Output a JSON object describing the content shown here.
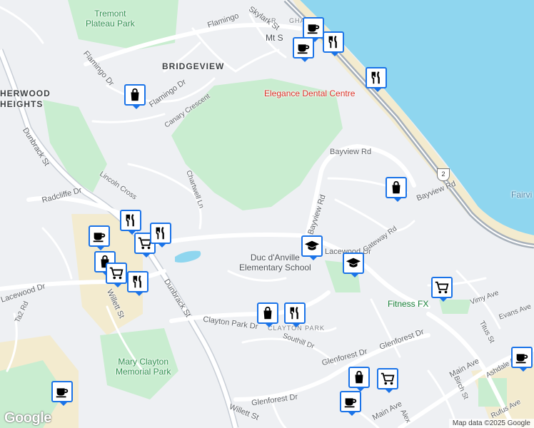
{
  "labels": {
    "park_tremont": "Tremont\nPlateau Park",
    "bridgeview": "BRIDGEVIEW",
    "herwood": "HERWOOD\nHEIGHTS",
    "flamingo_dr_1": "Flamingo Dr",
    "flamingo_dr_2": "Flamingo Dr",
    "flamingo_dr_3": "Flamingo",
    "skylark": "Skylark St",
    "canary": "Canary Crescent",
    "dunbrack_n": "Dunbrack St",
    "dunbrack_s": "Dunbrack St",
    "lincoln": "Lincoln Cross",
    "chartwell": "Chartwell Ln",
    "radcliffe": "Radcliffe Dr",
    "lacewood_w": "Lacewood Dr",
    "lacewood_e": "Lacewood Dr",
    "ta2": "Ta2 Rd",
    "willett_n": "Willett St",
    "willett_s": "Willett St",
    "bayview_1": "Bayview Rd",
    "bayview_2": "Bayview Rd",
    "bayview_3": "Bayview Rd",
    "gateway": "Gateway Rd",
    "school": "Duc d'Anville\nElementary School",
    "dental": "Elegance Dental Centre",
    "fitness": "Fitness FX",
    "fairview": "Fairvi",
    "clayton": "Clayton Park Dr",
    "clayton_park": "CLAYTON PARK",
    "southill": "Southill Dr",
    "glenforest_1": "Glenforest Dr",
    "glenforest_2": "Glenforest Dr",
    "glenforest_3": "Glenforest Dr",
    "mary_clayton": "Mary Clayton\nMemorial Park",
    "main_ave_1": "Main Ave",
    "main_ave_2": "Main Ave",
    "vimy": "Vimy Ave",
    "evans": "Evans Ave",
    "titus": "Titus St",
    "ashdale": "Ashdale Ave",
    "birch": "Birch St",
    "rufus": "Rufus Ave",
    "alex": "Alex",
    "mt_st": "Mt S",
    "rockingham": "R     GHAM",
    "highway": "2"
  },
  "poi_markers": [
    {
      "icon": "shopping-bag-icon"
    },
    {
      "icon": "shopping-cart-icon"
    },
    {
      "icon": "restaurant-icon"
    },
    {
      "icon": "cafe-icon"
    },
    {
      "icon": "school-icon"
    }
  ],
  "branding": {
    "logo": "Google",
    "attribution": "Map data ©2025 Google"
  },
  "colors": {
    "land": "#eef0f3",
    "water": "#8fd6ef",
    "park": "#c9edd0",
    "commercial": "#f3ebcf",
    "road": "#ffffff",
    "highway": "#a7b0ba",
    "marker_border": "#1a73e8",
    "park_text": "#2f8f4e"
  }
}
